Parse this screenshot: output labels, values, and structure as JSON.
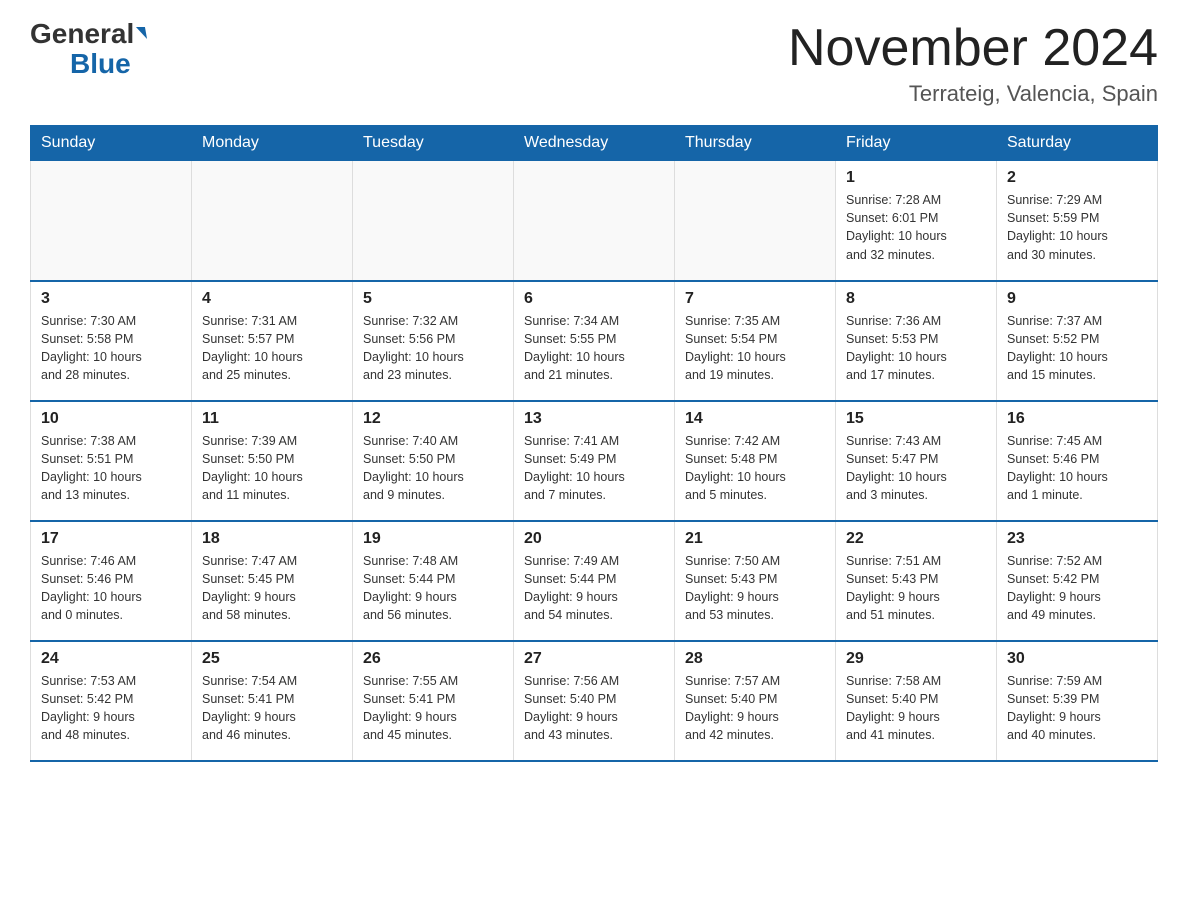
{
  "header": {
    "logo_general": "General",
    "logo_blue": "Blue",
    "month_title": "November 2024",
    "location": "Terrateig, Valencia, Spain"
  },
  "weekdays": [
    "Sunday",
    "Monday",
    "Tuesday",
    "Wednesday",
    "Thursday",
    "Friday",
    "Saturday"
  ],
  "weeks": [
    [
      {
        "day": "",
        "info": ""
      },
      {
        "day": "",
        "info": ""
      },
      {
        "day": "",
        "info": ""
      },
      {
        "day": "",
        "info": ""
      },
      {
        "day": "",
        "info": ""
      },
      {
        "day": "1",
        "info": "Sunrise: 7:28 AM\nSunset: 6:01 PM\nDaylight: 10 hours\nand 32 minutes."
      },
      {
        "day": "2",
        "info": "Sunrise: 7:29 AM\nSunset: 5:59 PM\nDaylight: 10 hours\nand 30 minutes."
      }
    ],
    [
      {
        "day": "3",
        "info": "Sunrise: 7:30 AM\nSunset: 5:58 PM\nDaylight: 10 hours\nand 28 minutes."
      },
      {
        "day": "4",
        "info": "Sunrise: 7:31 AM\nSunset: 5:57 PM\nDaylight: 10 hours\nand 25 minutes."
      },
      {
        "day": "5",
        "info": "Sunrise: 7:32 AM\nSunset: 5:56 PM\nDaylight: 10 hours\nand 23 minutes."
      },
      {
        "day": "6",
        "info": "Sunrise: 7:34 AM\nSunset: 5:55 PM\nDaylight: 10 hours\nand 21 minutes."
      },
      {
        "day": "7",
        "info": "Sunrise: 7:35 AM\nSunset: 5:54 PM\nDaylight: 10 hours\nand 19 minutes."
      },
      {
        "day": "8",
        "info": "Sunrise: 7:36 AM\nSunset: 5:53 PM\nDaylight: 10 hours\nand 17 minutes."
      },
      {
        "day": "9",
        "info": "Sunrise: 7:37 AM\nSunset: 5:52 PM\nDaylight: 10 hours\nand 15 minutes."
      }
    ],
    [
      {
        "day": "10",
        "info": "Sunrise: 7:38 AM\nSunset: 5:51 PM\nDaylight: 10 hours\nand 13 minutes."
      },
      {
        "day": "11",
        "info": "Sunrise: 7:39 AM\nSunset: 5:50 PM\nDaylight: 10 hours\nand 11 minutes."
      },
      {
        "day": "12",
        "info": "Sunrise: 7:40 AM\nSunset: 5:50 PM\nDaylight: 10 hours\nand 9 minutes."
      },
      {
        "day": "13",
        "info": "Sunrise: 7:41 AM\nSunset: 5:49 PM\nDaylight: 10 hours\nand 7 minutes."
      },
      {
        "day": "14",
        "info": "Sunrise: 7:42 AM\nSunset: 5:48 PM\nDaylight: 10 hours\nand 5 minutes."
      },
      {
        "day": "15",
        "info": "Sunrise: 7:43 AM\nSunset: 5:47 PM\nDaylight: 10 hours\nand 3 minutes."
      },
      {
        "day": "16",
        "info": "Sunrise: 7:45 AM\nSunset: 5:46 PM\nDaylight: 10 hours\nand 1 minute."
      }
    ],
    [
      {
        "day": "17",
        "info": "Sunrise: 7:46 AM\nSunset: 5:46 PM\nDaylight: 10 hours\nand 0 minutes."
      },
      {
        "day": "18",
        "info": "Sunrise: 7:47 AM\nSunset: 5:45 PM\nDaylight: 9 hours\nand 58 minutes."
      },
      {
        "day": "19",
        "info": "Sunrise: 7:48 AM\nSunset: 5:44 PM\nDaylight: 9 hours\nand 56 minutes."
      },
      {
        "day": "20",
        "info": "Sunrise: 7:49 AM\nSunset: 5:44 PM\nDaylight: 9 hours\nand 54 minutes."
      },
      {
        "day": "21",
        "info": "Sunrise: 7:50 AM\nSunset: 5:43 PM\nDaylight: 9 hours\nand 53 minutes."
      },
      {
        "day": "22",
        "info": "Sunrise: 7:51 AM\nSunset: 5:43 PM\nDaylight: 9 hours\nand 51 minutes."
      },
      {
        "day": "23",
        "info": "Sunrise: 7:52 AM\nSunset: 5:42 PM\nDaylight: 9 hours\nand 49 minutes."
      }
    ],
    [
      {
        "day": "24",
        "info": "Sunrise: 7:53 AM\nSunset: 5:42 PM\nDaylight: 9 hours\nand 48 minutes."
      },
      {
        "day": "25",
        "info": "Sunrise: 7:54 AM\nSunset: 5:41 PM\nDaylight: 9 hours\nand 46 minutes."
      },
      {
        "day": "26",
        "info": "Sunrise: 7:55 AM\nSunset: 5:41 PM\nDaylight: 9 hours\nand 45 minutes."
      },
      {
        "day": "27",
        "info": "Sunrise: 7:56 AM\nSunset: 5:40 PM\nDaylight: 9 hours\nand 43 minutes."
      },
      {
        "day": "28",
        "info": "Sunrise: 7:57 AM\nSunset: 5:40 PM\nDaylight: 9 hours\nand 42 minutes."
      },
      {
        "day": "29",
        "info": "Sunrise: 7:58 AM\nSunset: 5:40 PM\nDaylight: 9 hours\nand 41 minutes."
      },
      {
        "day": "30",
        "info": "Sunrise: 7:59 AM\nSunset: 5:39 PM\nDaylight: 9 hours\nand 40 minutes."
      }
    ]
  ]
}
